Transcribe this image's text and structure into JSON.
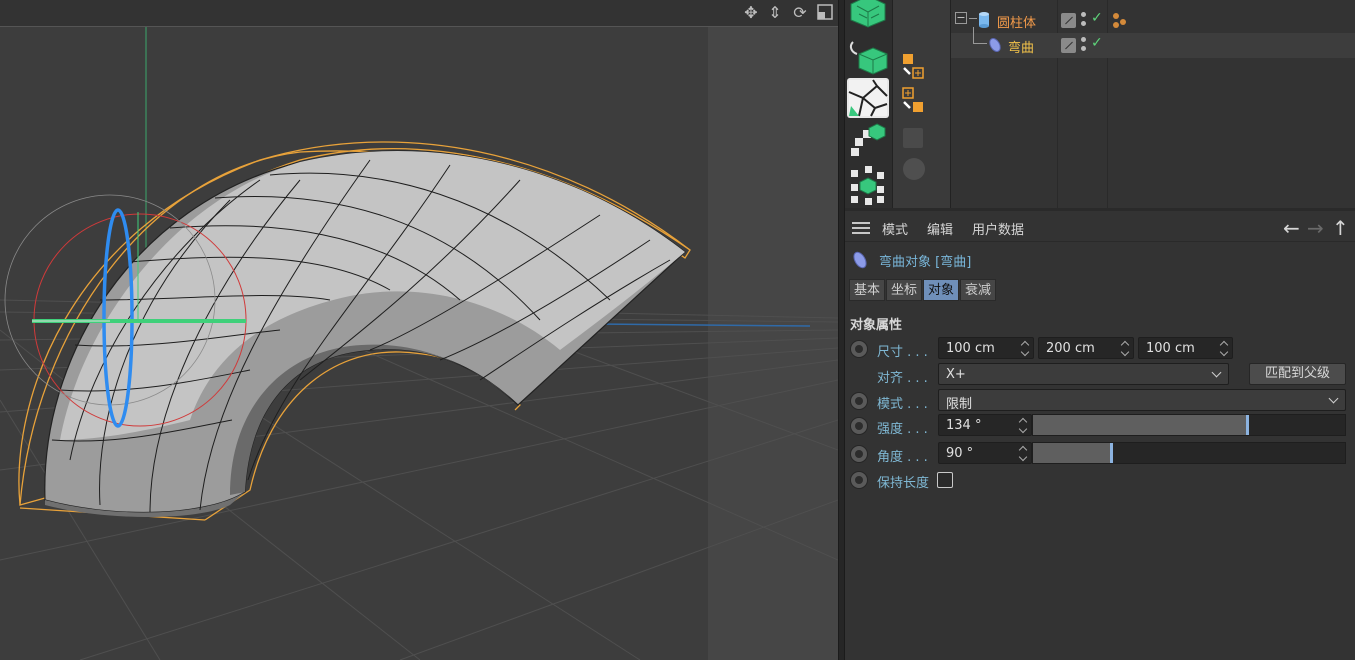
{
  "object_manager": {
    "rows": [
      {
        "name": "圆柱体",
        "type": "cylinder",
        "color": "#f29a4a"
      },
      {
        "name": "弯曲",
        "type": "bend",
        "color": "#f2c24a"
      }
    ]
  },
  "attributes": {
    "menu": [
      "模式",
      "编辑",
      "用户数据"
    ],
    "object_title": "弯曲对象 [弯曲]",
    "tabs": [
      "基本",
      "坐标",
      "对象",
      "衰减"
    ],
    "active_tab": "对象",
    "section_title": "对象属性",
    "size": {
      "label": "尺寸 . . .",
      "x": "100 cm",
      "y": "200 cm",
      "z": "100 cm"
    },
    "align": {
      "label": "对齐 . . .",
      "value": "X+",
      "button": "匹配到父级"
    },
    "mode": {
      "label": "模式 . . .",
      "value": "限制"
    },
    "strength": {
      "label": "强度 . . .",
      "value": "134 °",
      "fraction": 0.685
    },
    "angle": {
      "label": "角度 . . .",
      "value": "90 °",
      "fraction": 0.25
    },
    "keep_length": {
      "label": "保持长度",
      "checked": false
    }
  },
  "colors": {
    "accent": "#6f8fb9",
    "label_blue": "#7fb8d4",
    "selection_orange": "#e8a23a",
    "axis_green": "#3fd07a",
    "axis_blue": "#2f8cf0",
    "axis_red": "#d03a3a"
  },
  "icons": {
    "viewport_nav": [
      "move-view-icon",
      "dolly-view-icon",
      "rotate-view-icon",
      "maximize-view-icon"
    ],
    "palette": [
      "mesh-cube-icon",
      "cube-generator-icon",
      "voronoi-fracture-icon",
      "mograph-cloner-icon",
      "matrix-icon"
    ]
  }
}
